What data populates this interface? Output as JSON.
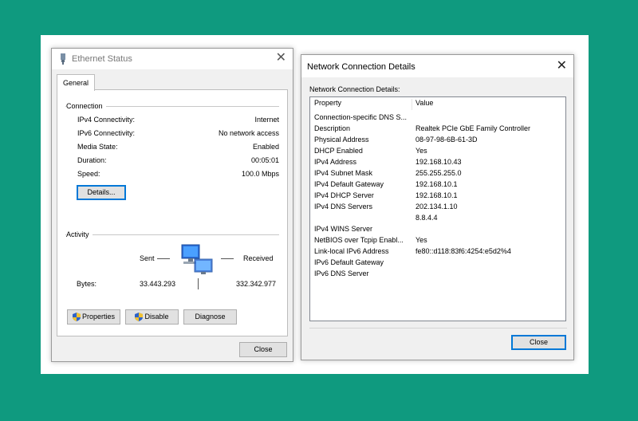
{
  "ethernet": {
    "title": "Ethernet Status",
    "tab": "General",
    "connection_label": "Connection",
    "rows": [
      {
        "label": "IPv4 Connectivity:",
        "value": "Internet"
      },
      {
        "label": "IPv6 Connectivity:",
        "value": "No network access"
      },
      {
        "label": "Media State:",
        "value": "Enabled"
      },
      {
        "label": "Duration:",
        "value": "00:05:01"
      },
      {
        "label": "Speed:",
        "value": "100.0 Mbps"
      }
    ],
    "details_button": "Details...",
    "activity_label": "Activity",
    "sent_label": "Sent",
    "received_label": "Received",
    "bytes_label": "Bytes:",
    "bytes_sent": "33.443.293",
    "bytes_received": "332.342.977",
    "properties_button": "Properties",
    "disable_button": "Disable",
    "diagnose_button": "Diagnose",
    "close_button": "Close"
  },
  "details": {
    "title": "Network Connection Details",
    "section_label": "Network Connection Details:",
    "col_property": "Property",
    "col_value": "Value",
    "rows": [
      {
        "p": "Connection-specific DNS S...",
        "v": ""
      },
      {
        "p": "Description",
        "v": "Realtek PCIe GbE Family Controller"
      },
      {
        "p": "Physical Address",
        "v": "08-97-98-6B-61-3D"
      },
      {
        "p": "DHCP Enabled",
        "v": "Yes"
      },
      {
        "p": "IPv4 Address",
        "v": "192.168.10.43"
      },
      {
        "p": "IPv4 Subnet Mask",
        "v": "255.255.255.0"
      },
      {
        "p": "IPv4 Default Gateway",
        "v": "192.168.10.1"
      },
      {
        "p": "IPv4 DHCP Server",
        "v": "192.168.10.1"
      },
      {
        "p": "IPv4 DNS Servers",
        "v": "202.134.1.10"
      },
      {
        "p": "",
        "v": "8.8.4.4"
      },
      {
        "p": "IPv4 WINS Server",
        "v": ""
      },
      {
        "p": "NetBIOS over Tcpip Enabl...",
        "v": "Yes"
      },
      {
        "p": "Link-local IPv6 Address",
        "v": "fe80::d118:83f6:4254:e5d2%4"
      },
      {
        "p": "IPv6 Default Gateway",
        "v": ""
      },
      {
        "p": "IPv6 DNS Server",
        "v": ""
      }
    ],
    "close_button": "Close"
  },
  "colors": {
    "background": "#0f9a7f",
    "focus": "#0078d7"
  },
  "icons": [
    "ethernet-icon",
    "close-icon",
    "network-computers-icon",
    "uac-shield-icon"
  ]
}
